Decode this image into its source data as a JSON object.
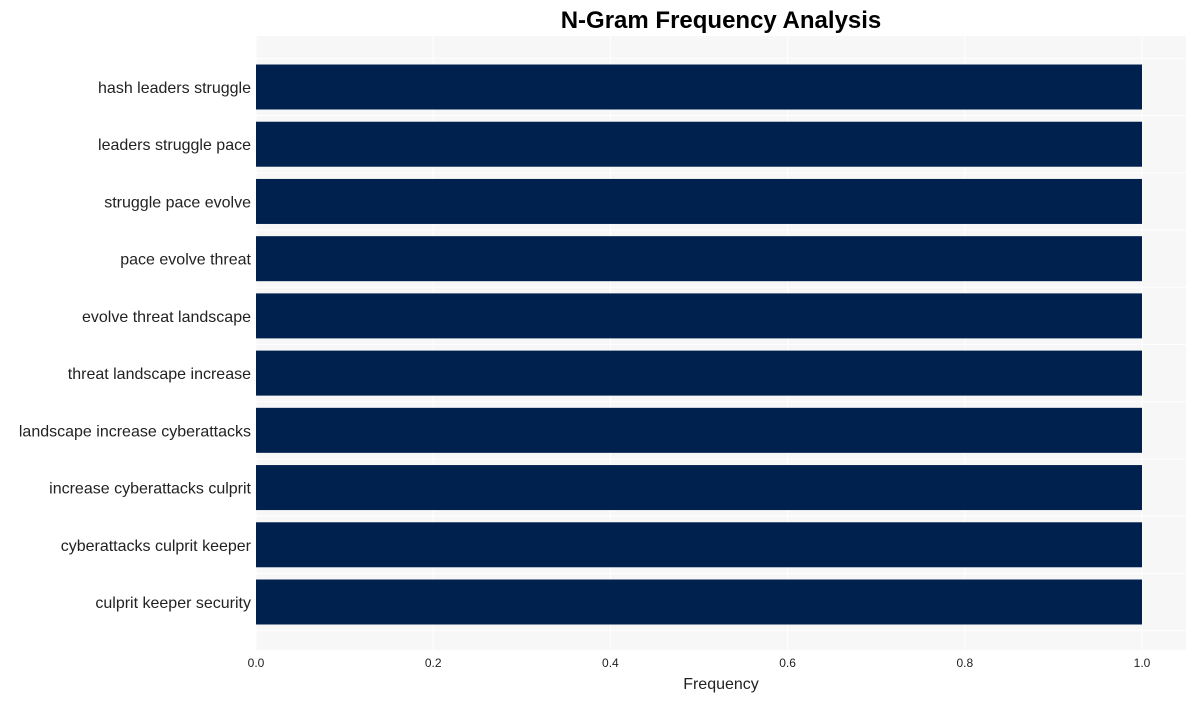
{
  "chart_data": {
    "type": "bar",
    "orientation": "horizontal",
    "title": "N-Gram Frequency Analysis",
    "xlabel": "Frequency",
    "ylabel": "",
    "categories": [
      "hash leaders struggle",
      "leaders struggle pace",
      "struggle pace evolve",
      "pace evolve threat",
      "evolve threat landscape",
      "threat landscape increase",
      "landscape increase cyberattacks",
      "increase cyberattacks culprit",
      "cyberattacks culprit keeper",
      "culprit keeper security"
    ],
    "values": [
      1,
      1,
      1,
      1,
      1,
      1,
      1,
      1,
      1,
      1
    ],
    "xlim": [
      0,
      1.05
    ],
    "xticks": [
      "0.0",
      "0.2",
      "0.4",
      "0.6",
      "0.8",
      "1.0"
    ],
    "grid": true,
    "legend": "none",
    "colors": {
      "bar": "#00214d",
      "plot_background": "#f7f7f7",
      "grid": "#ffffff"
    }
  }
}
